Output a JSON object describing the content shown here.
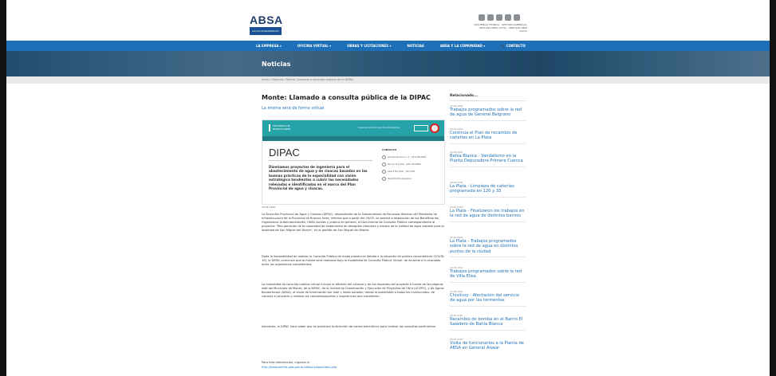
{
  "header": {
    "logo_text": "ABSA",
    "logo_sub": "AGUAS BONAERENSES S.A.",
    "contact_lines": [
      "ASISTENCIA TÉCNICA  ·  GESTIÓN COMERCIAL",
      "0800-999-4884 (2272)  ·  0800-999-4884 (2272)"
    ]
  },
  "nav": {
    "items": [
      "LA EMPRESA ▾",
      "OFICINA VIRTUAL ▾",
      "OBRAS Y LICITACIONES ▾",
      "NOTICIAS",
      "ABSA Y LA COMUNIDAD ▾",
      "📞 CONTACTO"
    ]
  },
  "banner": {
    "title": "Noticias"
  },
  "breadcrumb": "Inicio  /  Noticias  /  Monte: Llamado a consulta pública de la DIPAC",
  "article": {
    "title": "Monte: Llamado a consulta pública de la DIPAC",
    "subtitle": "La misma será de forma virtual",
    "doc": {
      "brand": "PROVINCIA DE BUENOS AIRES",
      "links": "Áreas de Gobierno     Servicios     Novedades",
      "heading": "DIPAC",
      "description": "Diseñamos proyectos de ingeniería para el abastecimiento de agua y de cloacas basadas en las buenas prácticas de la especialidad con visión estratégica tendientes a cubrir las necesidades relevadas e identificadas en el marco del Plan Provincial de agua y cloacas.",
      "contact_heading": "CONTACTO",
      "contact_rows": [
        "Avenida 44 entre 1 y 2 · (221) 000-0000",
        "Horario: 8 a 14hs · (221) 429-5800",
        "Calle 2 Nro 1000 · (221) 000",
        "dipac@minfra.gba.gob.ar"
      ]
    },
    "date": "18-05-2020",
    "paragraphs": [
      "La Dirección Provincial de Agua y Cloacas (DIPAC), dependiente de la Subsecretaría de Recursos Hídricos del Ministerio de Infraestructura de la Provincia de Buenos Aires, informa que a partir del 29/05, se pondrá a disposición de los Beneficiarios, Organismos Gubernamentales, ONGs locales y público en general, el Documento de Consulta Pública correspondiente al proyecto: \"Recuperación de la capacidad de tratamiento de desagües cloacales y mejora de la calidad de agua potable para la localidad de San Miguel del Monte\", en el partido de San Miguel del Monte.",
      "Dada la imposibilidad de realizar la Consulta Pública de modo presencial debido a la situación de público conocimiento (COVID-19), la DIPAC comunica que la misma será realizada bajo la modalidad de Consulta Pública Virtual, de acuerdo a lo acordado entre los organismos competentes.",
      "La modalidad de consulta pública virtual incluye la difusión del alcance y de los impactos del proyecto a través de las páginas web del Municipio de Monte, de la DIPAC, de la Unidad de Coordinación y Ejecución de Proyectos de Obra (UCEPO), y de Aguas Bonaerenses (ABSA), el envío de información por mail y redes sociales, dando la posibilidad a todos los involucrados, de conocer el proyecto y realizar las consultas/aportes y sugerencias que consideren.",
      "Asimismo, la DIPAC hace saber que se publicará la dirección de correo electrónico para realizar las consultas pertinentes."
    ],
    "more_info": "Para más información, ingresar a:",
    "more_link": "http://www.minfra.gba.gov.ar/sitios/ucepo/index.php"
  },
  "sidebar": {
    "title": "Relacionado...",
    "items": [
      {
        "date": "27-05-2020",
        "title": "Trabajos programados sobre la red de agua de General Belgrano"
      },
      {
        "date": "26-05-2020",
        "title": "Continúa el Plan de recambio de cañerías en La Plata"
      },
      {
        "date": "26-05-2020",
        "title": "Bahía Blanca - Vandalismo en la Planta Depuradora Primera Cuenca"
      },
      {
        "date": "26-05-2020",
        "title": "La Plata - Limpieza de cañerías programada en 120 y 33"
      },
      {
        "date": "26-05-2020",
        "title": "La Plata - Finalizaron los trabajos en la red de agua de distintos barrios"
      },
      {
        "date": "22-05-2020",
        "title": "La Plata - Trabajos programados sobre la red de agua en distintos puntos de la ciudad"
      },
      {
        "date": "22-05-2020",
        "title": "Trabajos programados sobre la red de Villa Elisa"
      },
      {
        "date": "21-05-2020",
        "title": "Chivilcoy - Afectación del servicio de agua por las tormentas"
      },
      {
        "date": "20-05-2020",
        "title": "Recambio de bomba en el Barrio El Saladero de Bahía Blanca"
      },
      {
        "date": "20-05-2020",
        "title": "Visita de funcionarios a la Planta de ABSA en General Alvear"
      }
    ]
  },
  "colors": {
    "primary": "#1d70b7",
    "doc_teal": "#25a3a8",
    "text": "#333333"
  }
}
